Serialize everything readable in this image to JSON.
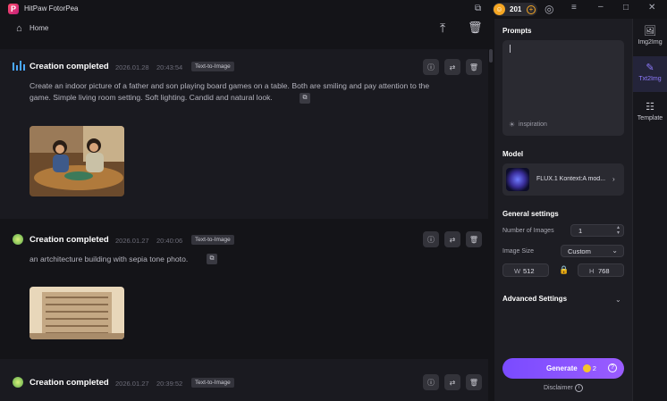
{
  "app": {
    "title": "HitPaw FotorPea",
    "logo_letter": "P"
  },
  "titlebar": {
    "credits": "201"
  },
  "nav": {
    "home_label": "Home"
  },
  "cards": [
    {
      "title": "Creation completed",
      "date": "2026.01.28",
      "time": "20:43:54",
      "badge": "Text-to-Image",
      "prompt_line1": "Create an indoor picture of a father and son playing board games on a table. Both are smiling and pay attention to the",
      "prompt_line2": "game.  Simple living room setting. Soft lighting. Candid and natural look."
    },
    {
      "title": "Creation completed",
      "date": "2026.01.27",
      "time": "20:40:06",
      "badge": "Text-to-Image",
      "prompt_line1": "an artchitecture building with sepia tone photo."
    },
    {
      "title": "Creation completed",
      "date": "2026.01.27",
      "time": "20:39:52",
      "badge": "Text-to-Image"
    }
  ],
  "panel": {
    "prompts_title": "Prompts",
    "inspiration": "inspiration",
    "model_title": "Model",
    "model_name": "FLUX.1 Kontext:A mod...",
    "general_title": "General settings",
    "num_images_label": "Number of Images",
    "num_images_value": "1",
    "image_size_label": "Image Size",
    "image_size_value": "Custom",
    "width_label": "W",
    "width_value": "512",
    "height_label": "H",
    "height_value": "768",
    "advanced_title": "Advanced Settings",
    "generate_label": "Generate",
    "generate_cost": "2",
    "disclaimer": "Disclaimer"
  },
  "rnav": [
    {
      "label": "Img2Img",
      "icon": "image-icon"
    },
    {
      "label": "Txt2Img",
      "icon": "edit-image-icon"
    },
    {
      "label": "Template",
      "icon": "grid-icon"
    }
  ],
  "colors": {
    "accent": "#8f7bff",
    "generate": "#7a4bff",
    "coin": "#f5a623"
  }
}
